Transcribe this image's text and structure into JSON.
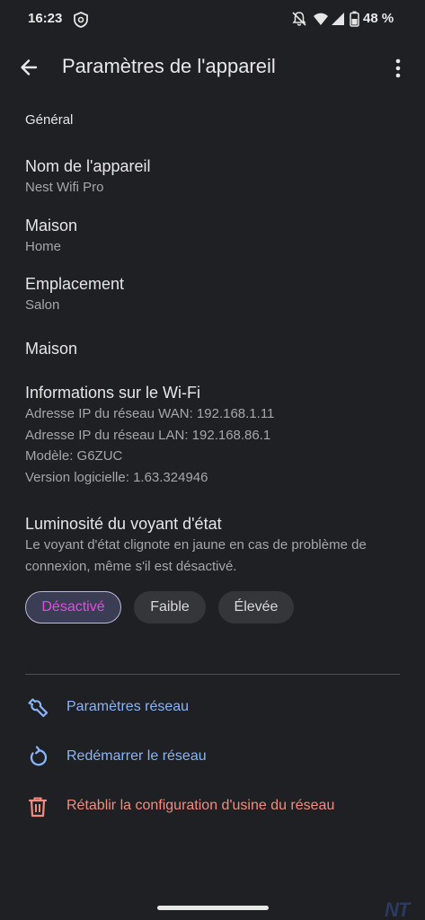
{
  "status_bar": {
    "time": "16:23",
    "battery_percent": "48 %"
  },
  "app_bar": {
    "title": "Paramètres de l'appareil"
  },
  "general": {
    "header": "Général",
    "device_name": {
      "title": "Nom de l'appareil",
      "value": "Nest Wifi Pro"
    },
    "home": {
      "title": "Maison",
      "value": "Home"
    },
    "location": {
      "title": "Emplacement",
      "value": "Salon"
    },
    "home_link": {
      "title": "Maison"
    }
  },
  "wifi_info": {
    "title": "Informations sur le Wi-Fi",
    "wan_ip": "Adresse IP du réseau WAN: 192.168.1.11",
    "lan_ip": "Adresse IP du réseau LAN: 192.168.86.1",
    "model": "Modèle: G6ZUC",
    "software": "Version logicielle: 1.63.324946"
  },
  "status_light": {
    "title": "Luminosité du voyant d'état",
    "description": "Le voyant d'état clignote en jaune en cas de problème de connexion, même s'il est désactivé.",
    "options": [
      "Désactivé",
      "Faible",
      "Élevée"
    ],
    "selected": "Désactivé"
  },
  "actions": {
    "network_settings": "Paramètres réseau",
    "restart_network": "Redémarrer le réseau",
    "factory_reset": "Rétablir la configuration d'usine du réseau"
  },
  "colors": {
    "background": "#1f2023",
    "accent_blue": "#8ab4f8",
    "danger_red": "#f28b82",
    "selected_chip_text": "#e34be3"
  },
  "icons": {
    "back": "arrow-left-icon",
    "more": "more-vert-icon",
    "network_settings": "wrench-icon",
    "restart": "restart-icon",
    "reset": "trash-icon"
  }
}
